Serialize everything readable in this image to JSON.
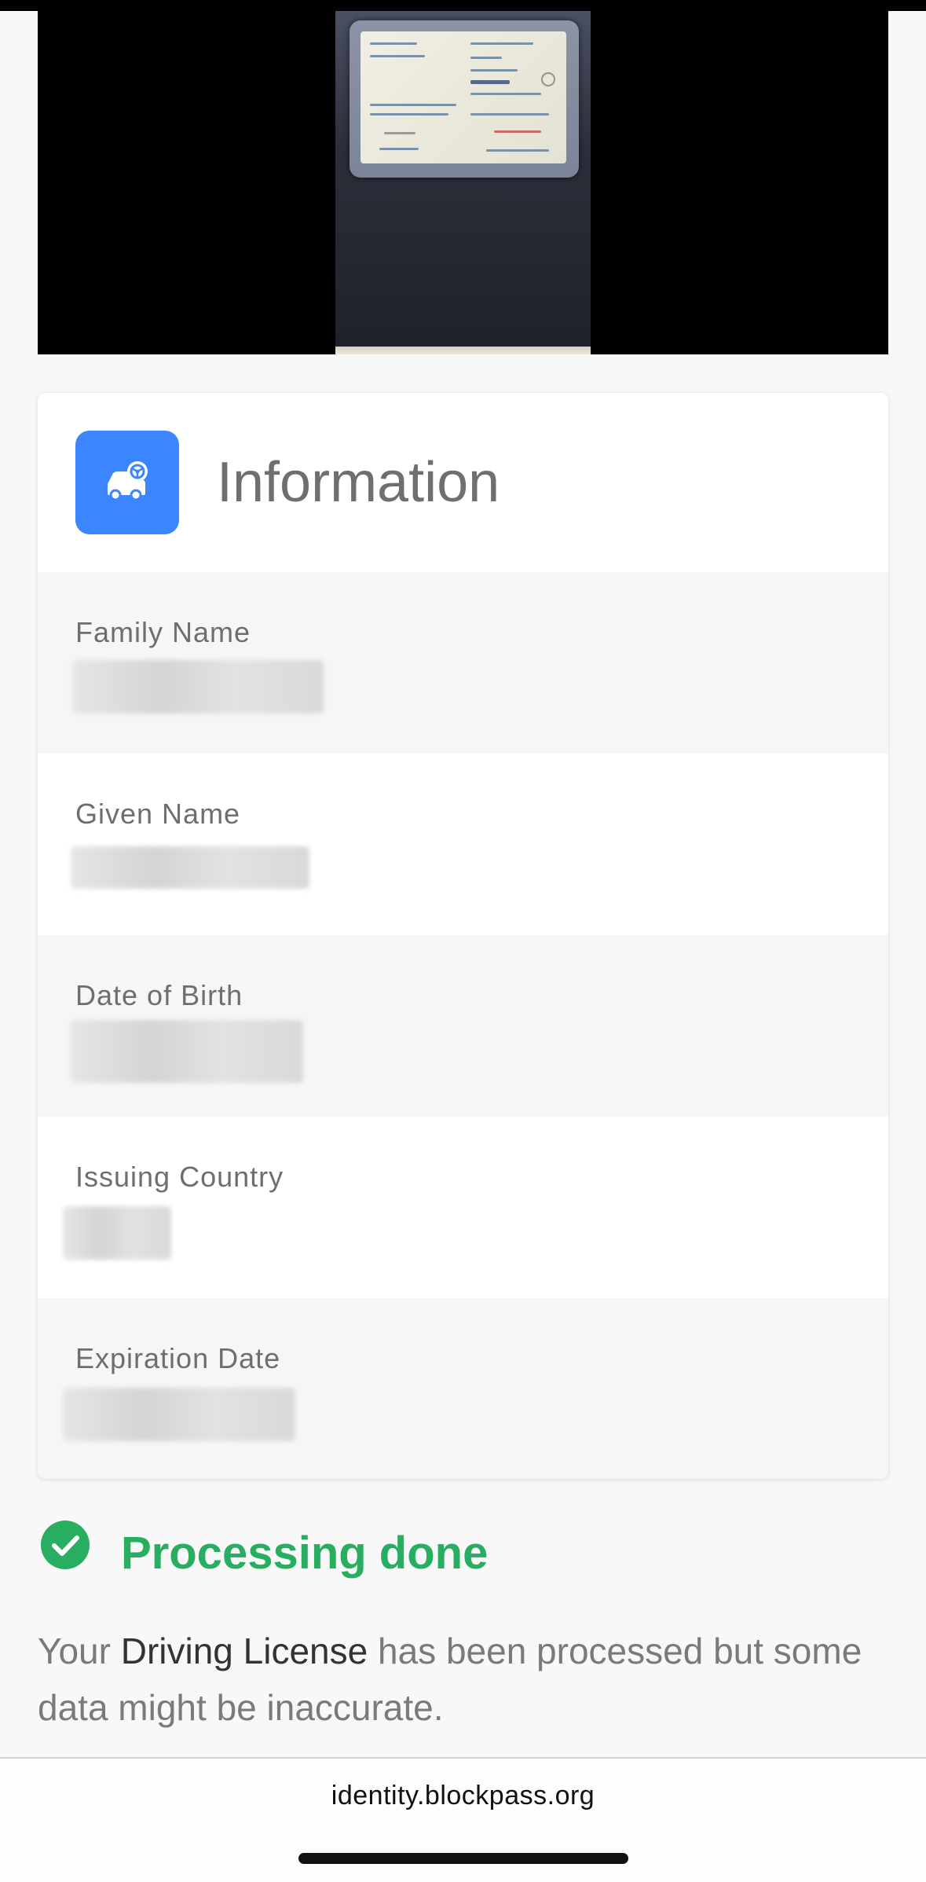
{
  "document_photo": {
    "alt": "Photo of driving license"
  },
  "info_card": {
    "title": "Information",
    "icon": "car-license-icon",
    "icon_color": "#3b86ff",
    "fields": [
      {
        "label": "Family Name"
      },
      {
        "label": "Given Name"
      },
      {
        "label": "Date of Birth"
      },
      {
        "label": "Issuing Country"
      },
      {
        "label": "Expiration Date"
      }
    ]
  },
  "status": {
    "icon": "check-circle-icon",
    "text": "Processing done",
    "color": "#27ae60"
  },
  "message": {
    "prefix": "Your ",
    "document_type": "Driving License",
    "suffix": " has been processed but some data might be inaccurate."
  },
  "browser": {
    "url": "identity.blockpass.org"
  }
}
